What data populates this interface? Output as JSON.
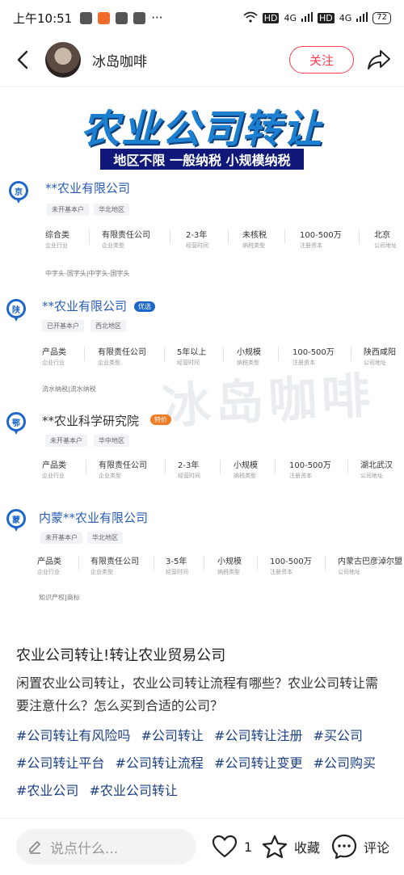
{
  "status_bar": {
    "time": "上午10:51",
    "more": "···",
    "net_1": "HD",
    "net_2": "4G",
    "net_3": "HD",
    "net_4": "4G",
    "battery": "72"
  },
  "header": {
    "author_name": "冰岛咖啡",
    "follow_label": "关注"
  },
  "note_image": {
    "banner_title": "农业公司转让",
    "banner_subtitle": "地区不限 一般纳税 小规模纳税",
    "watermark": "冰岛咖啡",
    "cards": [
      {
        "region_char": "京",
        "name": "**农业有限公司",
        "badge": "",
        "tags": [
          "未开基本户",
          "华北地区"
        ],
        "attributes": [
          {
            "value": "综合类",
            "label": "企业行业"
          },
          {
            "value": "有限责任公司",
            "label": "企业类型"
          },
          {
            "value": "2-3年",
            "label": "经营时间"
          },
          {
            "value": "未核税",
            "label": "纳税类型"
          },
          {
            "value": "100-500万",
            "label": "注册资本"
          },
          {
            "value": "北京",
            "label": "公司地址"
          }
        ],
        "scope": "中字头-国字头|中字头-国字头"
      },
      {
        "region_char": "陕",
        "name": "**农业有限公司",
        "badge": "优选",
        "tags": [
          "已开基本户",
          "西北地区"
        ],
        "attributes": [
          {
            "value": "产品类",
            "label": "企业行业"
          },
          {
            "value": "有限责任公司",
            "label": "企业类型"
          },
          {
            "value": "5年以上",
            "label": "经营时间"
          },
          {
            "value": "小规模",
            "label": "纳税类型"
          },
          {
            "value": "100-500万",
            "label": "注册资本"
          },
          {
            "value": "陕西咸阳",
            "label": "公司地址"
          }
        ],
        "scope": "流水纳税|流水纳税"
      },
      {
        "region_char": "鄂",
        "name": "**农业科学研究院",
        "badge": "特价",
        "tags": [
          "未开基本户",
          "华中地区"
        ],
        "attributes": [
          {
            "value": "产品类",
            "label": "企业行业"
          },
          {
            "value": "有限责任公司",
            "label": "企业类型"
          },
          {
            "value": "2-3年",
            "label": "经营时间"
          },
          {
            "value": "小规模",
            "label": "纳税类型"
          },
          {
            "value": "100-500万",
            "label": "注册资本"
          },
          {
            "value": "湖北武汉",
            "label": "公司地址"
          }
        ],
        "scope": ""
      },
      {
        "region_char": "蒙",
        "name": "内蒙**农业有限公司",
        "badge": "",
        "tags": [
          "未开基本户",
          "华北地区"
        ],
        "attributes": [
          {
            "value": "产品类",
            "label": "企业行业"
          },
          {
            "value": "有限责任公司",
            "label": "企业类型"
          },
          {
            "value": "3-5年",
            "label": "经营时间"
          },
          {
            "value": "小规模",
            "label": "纳税类型"
          },
          {
            "value": "100-500万",
            "label": "注册资本"
          },
          {
            "value": "内蒙古巴彦淖尔盟",
            "label": "公司地址"
          }
        ],
        "scope": "知识产权|商标"
      }
    ]
  },
  "note": {
    "title": "农业公司转让!转让农业贸易公司",
    "body": "闲置农业公司转让，农业公司转让流程有哪些？农业公司转让需要注意什么？怎么买到合适的公司？",
    "hashtags": [
      "#公司转让有风险吗",
      "#公司转让",
      "#公司转让注册",
      "#买公司",
      "#公司转让平台",
      "#公司转让流程",
      "#公司转让变更",
      "#公司购买",
      "#农业公司",
      "#农业公司转让"
    ]
  },
  "bottom_bar": {
    "comment_placeholder": "说点什么...",
    "like_count": "1",
    "collect_label": "收藏",
    "comment_label": "评论"
  },
  "colors": {
    "accent": "#ff3b4f",
    "link": "#1b3f84",
    "card_blue": "#1e67c9",
    "banner_blue": "#1c7fd0",
    "subtitle_bg": "#10197a"
  }
}
